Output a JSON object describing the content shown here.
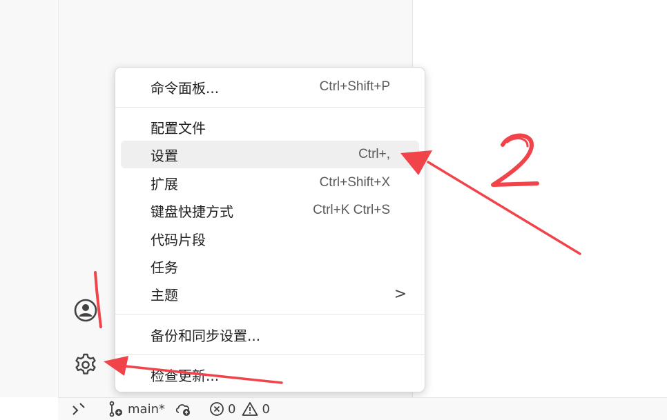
{
  "menu": {
    "items": [
      {
        "label": "命令面板...",
        "shortcut": "Ctrl+Shift+P"
      },
      {
        "label": "配置文件",
        "shortcut": ""
      },
      {
        "label": "设置",
        "shortcut": "Ctrl+,"
      },
      {
        "label": "扩展",
        "shortcut": "Ctrl+Shift+X"
      },
      {
        "label": "键盘快捷方式",
        "shortcut": "Ctrl+K Ctrl+S"
      },
      {
        "label": "代码片段",
        "shortcut": ""
      },
      {
        "label": "任务",
        "shortcut": ""
      },
      {
        "label": "主题",
        "shortcut": "",
        "submenu_glyph": ">"
      },
      {
        "label": "备份和同步设置...",
        "shortcut": ""
      },
      {
        "label": "检查更新...",
        "shortcut": ""
      }
    ],
    "highlighted_item": "设置"
  },
  "activity_bar": {
    "icons": [
      "account-icon",
      "manage-gear-icon"
    ]
  },
  "status_bar": {
    "remote_icon": "remote-indicator-icon",
    "branch": "main*",
    "sync_icon": "cloud-sync-icon",
    "errors": "0",
    "warnings": "0"
  },
  "annotations": {
    "mark_1": "1",
    "mark_2": "2",
    "color": "#f0434a"
  },
  "colors": {
    "menu_background": "#ffffff",
    "highlight_background": "#efefef",
    "sidebar_background": "#f8f8f8"
  }
}
